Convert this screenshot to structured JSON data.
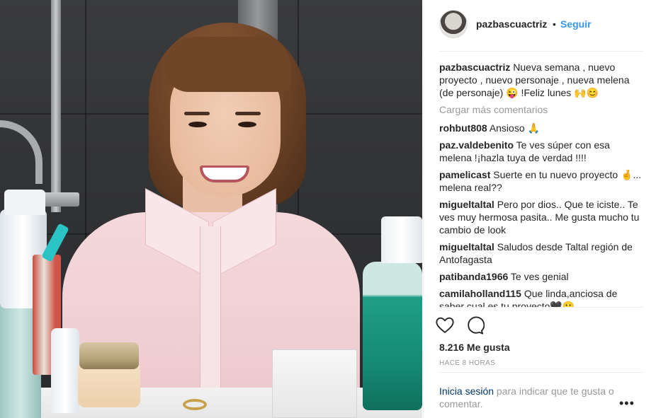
{
  "post": {
    "username": "pazbascuactriz",
    "separator": "•",
    "follow_label": "Seguir",
    "caption": "Nueva semana , nuevo proyecto , nuevo personaje , nueva melena (de personaje) 😜 !Feliz lunes 🙌😊",
    "load_more_label": "Cargar más comentarios",
    "likes_label": "8.216 Me gusta",
    "time_label": "HACE 8 HORAS",
    "login_link_label": "Inicia sesión",
    "login_rest": " para indicar que te gusta o comentar.",
    "more_label": "•••"
  },
  "comments": [
    {
      "user": "rohbut808",
      "text": "Ansioso 🙏"
    },
    {
      "user": "paz.valdebenito",
      "text": "Te ves súper con esa melena !¡hazla tuya de verdad !!!!"
    },
    {
      "user": "pamelicast",
      "text": "Suerte en tu nuevo proyecto 🤞... melena real??"
    },
    {
      "user": "migueltaltal",
      "text": "Pero por dios.. Que te iciste.. Te ves muy hermosa pasita.. Me gusta mucho tu cambio de look"
    },
    {
      "user": "migueltaltal",
      "text": "Saludos desde Taltal región de Antofagasta"
    },
    {
      "user": "patibanda1966",
      "text": "Te ves genial"
    },
    {
      "user": "camilaholland115",
      "text": "Que linda,anciosa de saber cual es tu proyecto🖤😬"
    }
  ],
  "icons": {
    "like": "heart-outline-icon",
    "comment": "speech-bubble-icon"
  },
  "colors": {
    "link_blue": "#3897f0",
    "text_dark": "#262626",
    "muted_gray": "#999999",
    "login_link": "#003569"
  }
}
